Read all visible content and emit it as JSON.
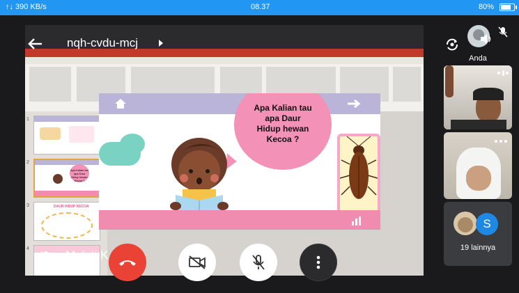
{
  "status_bar": {
    "left": "↑↓ 390 KB/s",
    "time": "08.37",
    "battery": "80%",
    "battery_level": 0.8
  },
  "meeting": {
    "code": "nqh-cvdu-mcj",
    "presenter_label": "Melati K"
  },
  "slide": {
    "question": "Apa Kalian tau\napa Daur\nHidup hewan\nKecoa ?"
  },
  "thumbnails": [
    {
      "num": "1"
    },
    {
      "num": "2",
      "text": "Apa Kalian tau apa Daur Hidup hewan Kecoa ?"
    },
    {
      "num": "3",
      "text": "DAUR HIDUP KECOA"
    },
    {
      "num": "4"
    }
  ],
  "participants": {
    "self_label": "Anda",
    "others_count_label": "19 lainnya",
    "avatar_initial": "S"
  },
  "colors": {
    "hangup": "#ea4335",
    "status_bar": "#2196f3",
    "avatar_s": "#1e88e5"
  },
  "icons": [
    "back-arrow-icon",
    "chevron-right-icon",
    "switch-camera-icon",
    "mic-off-icon",
    "speaker-icon",
    "phone-hangup-icon",
    "camera-off-icon",
    "more-vert-icon",
    "pin-icon"
  ]
}
